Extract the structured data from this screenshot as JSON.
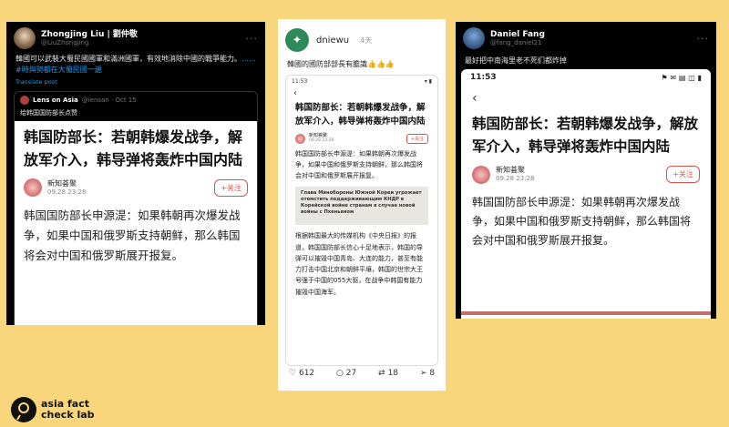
{
  "panel1": {
    "user_name": "Zhongjing Liu | 劉仲敬",
    "handle": "@LiuZhongjing",
    "text": "韓國可以武裝大蜀民國國軍和滿洲國軍，有效地消除中國的戰爭能力。",
    "link_text": "……#時與勢都在大蜀民國一邊",
    "translate": "Translate post",
    "quote_user": "Lens on Asia",
    "quote_handle": "@lensan · Oct 15",
    "quote_text": "给韩国国防部长点赞",
    "article_title": "韩国防部长：若朝韩爆发战争，解放军介入，韩导弹将轰炸中国内陆",
    "author_name": "新知荟聚",
    "author_date": "09.28  23:28",
    "follow": "+关注",
    "body": "韩国国防部长申源湜：如果韩朝再次爆发战争，如果中国和俄罗斯支持朝鲜，那么韩国将会对中国和俄罗斯展开报复。"
  },
  "panel2": {
    "user_name": "dniewu",
    "time": "4天",
    "text": "韓國的國防部部長有膽識👍👍👍",
    "status_time": "11:53",
    "article_title": "韩国防部长：若朝韩爆发战争，解放军介入，韩导弹将轰炸中国内陆",
    "author_name": "新知荟聚",
    "author_date": "09.28  23:28",
    "follow": "+关注",
    "body": "韩国国防部长申源湜：如果韩朝再次爆发战争，如果中国和俄罗斯支持朝鲜，那么韩国将会对中国和俄罗斯展开报复。",
    "embed_text": "Глава Минобороны Южной Кореи угрожает отомстить поддерживающим КНДР в Корейской войне странам в случае новой войны с Пхеньяном",
    "embed_source": "",
    "body2": "根据韩国最大的传媒机构《中央日报》的报道，韩国国防部长信心十足地表示，韩国的导弹可以摧毁中国青岛、大连的能力，甚至有能力打击中国北京和朝鲜平壤，韩国的世宗大王号强于中国的055大驱，在战争中韩国有能力摧毁中国海军。",
    "likes": "612",
    "comments": "27",
    "reposts": "18",
    "shares": "8"
  },
  "panel3": {
    "user_name": "Daniel Fang",
    "handle": "@fang_daniel21",
    "text": "最好把中南海里老不死们都炸掉",
    "status_time": "11:53",
    "article_title": "韩国防部长：若朝韩爆发战争，解放军介入，韩导弹将轰炸中国内陆",
    "author_name": "新知荟聚",
    "author_date": "09.28  23:28",
    "follow": "+关注",
    "body": "韩国国防部长申源湜：如果韩朝再次爆发战争，如果中国和俄罗斯支持朝鲜，那么韩国将会对中国和俄罗斯展开报复。"
  },
  "logo": {
    "line1": "asia fact",
    "line2": "check lab"
  },
  "colors": {
    "background": "#f9d67b",
    "accent_red": "#d9534f",
    "twitter_blue": "#1d9bf0"
  }
}
